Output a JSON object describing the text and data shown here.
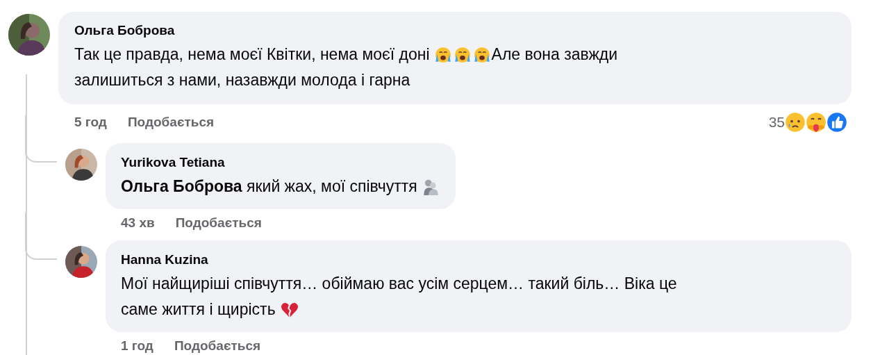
{
  "comment": {
    "author": "Ольга Боброва",
    "lines": [
      [
        {
          "kind": "text",
          "text": "Так це правда, нема моєї Квітки, нема моєї доні"
        },
        {
          "kind": "crying-emoji"
        },
        {
          "kind": "crying-emoji"
        },
        {
          "kind": "crying-emoji"
        },
        {
          "kind": "text",
          "text": "Але вона завжди"
        }
      ],
      [
        {
          "kind": "text",
          "text": "залишиться з нами, назавжди молода і гарна"
        }
      ]
    ],
    "time": "5 год",
    "like": "Подобається",
    "reactions": {
      "count": "35",
      "types": [
        {
          "kind": "sad"
        },
        {
          "kind": "care"
        },
        {
          "kind": "like"
        }
      ]
    }
  },
  "replies": [
    {
      "author": "Yurikova Tetiana",
      "lines": [
        [
          {
            "kind": "text",
            "text": "**Ольга Боброва** який жах, мої співчуття"
          },
          {
            "kind": "hug-emoji"
          }
        ]
      ],
      "time": "43 хв",
      "like": "Подобається"
    },
    {
      "author": "Hanna Kuzina",
      "lines": [
        [
          {
            "kind": "text",
            "text": "Мої найщиріші співчуття… обіймаю вас усім серцем… такий біль… Віка це"
          }
        ],
        [
          {
            "kind": "text",
            "text": "саме життя і щирість"
          },
          {
            "kind": "broken-heart-emoji"
          }
        ]
      ],
      "time": "1 год",
      "like": "Подобається"
    }
  ]
}
